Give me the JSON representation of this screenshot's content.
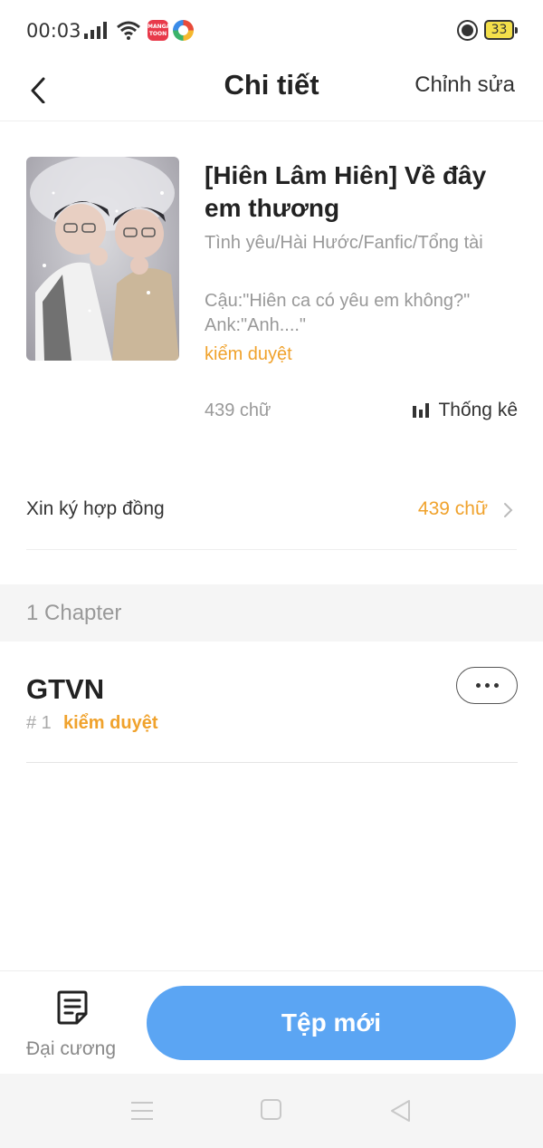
{
  "status_bar": {
    "time": "00:03",
    "battery": "33",
    "app_icon_label": "MANGA TOON"
  },
  "header": {
    "title": "Chi tiết",
    "edit_label": "Chỉnh sửa"
  },
  "book": {
    "title": "[Hiên Lâm Hiên] Về đây em thương",
    "genres": "Tình yêu/Hài Hước/Fanfic/Tổng tài",
    "description": "Cậu:\"Hiên ca có yêu em không?\" Ank:\"Anh....\"",
    "status": "kiểm duyệt",
    "word_count": "439 chữ",
    "stats_label": "Thống kê"
  },
  "contract": {
    "label": "Xin ký hợp đồng",
    "value": "439 chữ"
  },
  "chapters": {
    "section_label": "1 Chapter",
    "items": [
      {
        "title": "GTVN",
        "number": "# 1",
        "status": "kiểm duyệt"
      }
    ]
  },
  "bottom_bar": {
    "outline_label": "Đại cương",
    "new_label": "Tệp mới"
  },
  "colors": {
    "accent_orange": "#f0a22c",
    "primary_blue": "#5ba5f3"
  }
}
